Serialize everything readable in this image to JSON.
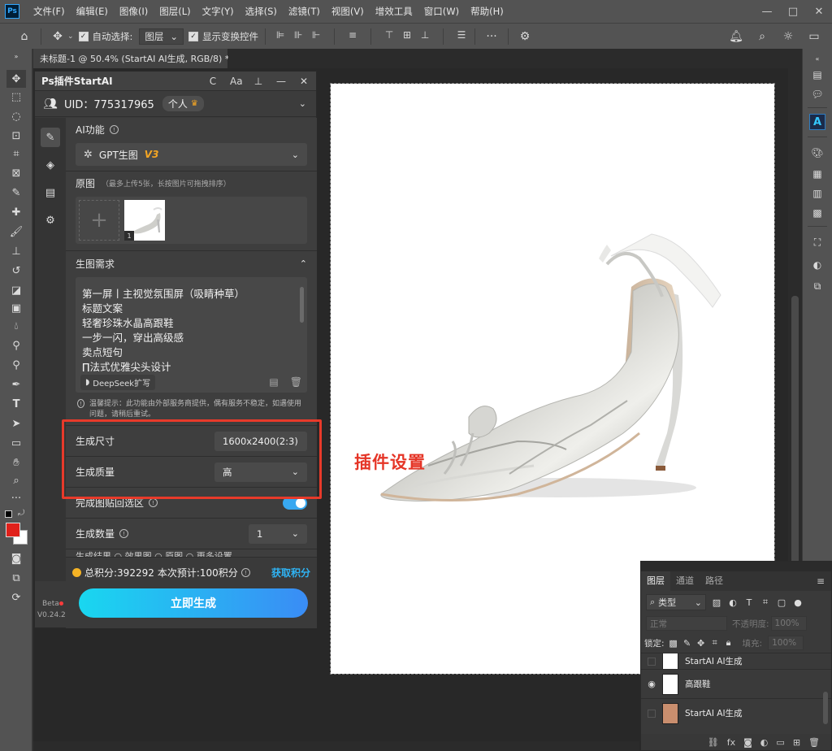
{
  "app": {
    "logo": "Ps",
    "menu": [
      "文件(F)",
      "编辑(E)",
      "图像(I)",
      "图层(L)",
      "文字(Y)",
      "选择(S)",
      "滤镜(T)",
      "视图(V)",
      "增效工具",
      "窗口(W)",
      "帮助(H)"
    ],
    "window_controls": {
      "minimize": "—",
      "restore": "□",
      "close": "✕"
    }
  },
  "options_bar": {
    "auto_select_label": "自动选择:",
    "auto_select_target": "图层",
    "show_transform_label": "显示变换控件",
    "more": "···"
  },
  "document_tab": {
    "title": "未标题-1 @ 50.4% (StartAI AI生成, RGB/8) *",
    "close": "×"
  },
  "plugin": {
    "title": "Ps插件StartAI",
    "header_icons": {
      "refresh": "C",
      "font": "Aa",
      "pin": "⊥",
      "minimize": "—",
      "close": "✕"
    },
    "uid": "UID：775317965",
    "plan": "个人",
    "beta": "Beta",
    "version": "V0.24.2",
    "ai_section": {
      "label": "AI功能",
      "model_name": "GPT生图",
      "model_version": "V3"
    },
    "original_section": {
      "label": "原图",
      "hint": "（最多上传5张，长按图片可拖拽排序）",
      "thumb_index": "1"
    },
    "prompt_section": {
      "label": "生图需求",
      "lines": [
        "第一屏丨主视觉氛围屏（吸睛种草）",
        "标题文案",
        "轻奢珍珠水晶高跟鞋",
        "一步一闪，穿出高级感",
        "卖点短句",
        "∏法式优雅尖头设计"
      ],
      "deepseek_label": "DeepSeek扩写",
      "notice": "温馨提示：此功能由外部服务商提供，偶有服务不稳定，如遇使用问题，请稍后重试。"
    },
    "settings": {
      "size_label": "生成尺寸",
      "size_value": "1600x2400(2:3)",
      "quality_label": "生成质量",
      "quality_value": "高",
      "paste_back_label": "完成图贴回选区",
      "paste_back_on": true,
      "count_label": "生成数量",
      "count_value": "1",
      "cut_row_text": "生成结果    ○ 效果图 ○ 原图    ○ 更多设置"
    },
    "footer": {
      "points_total": "总积分:392292",
      "points_estimate": "本次预计:100积分",
      "get_points": "获取积分",
      "generate": "立即生成"
    }
  },
  "annotation": {
    "text": "插件设置",
    "color": "#e53527"
  },
  "layers_panel": {
    "tabs": [
      "图层",
      "通道",
      "路径"
    ],
    "kind_label": "类型",
    "blend_mode": "正常",
    "opacity_label": "不透明度:",
    "opacity_value": "100%",
    "lock_label": "锁定:",
    "fill_label": "填充:",
    "fill_value": "100%",
    "layers": [
      {
        "name": "StartAI AI生成",
        "visible": false
      },
      {
        "name": "高跟鞋",
        "visible": true
      },
      {
        "name": "StartAI AI生成",
        "visible": false
      }
    ]
  },
  "colors": {
    "accent": "#2fb4f5",
    "foreground_swatch": "#e0201a",
    "background_swatch": "#ffffff",
    "highlight_frame": "#e83a2a"
  }
}
